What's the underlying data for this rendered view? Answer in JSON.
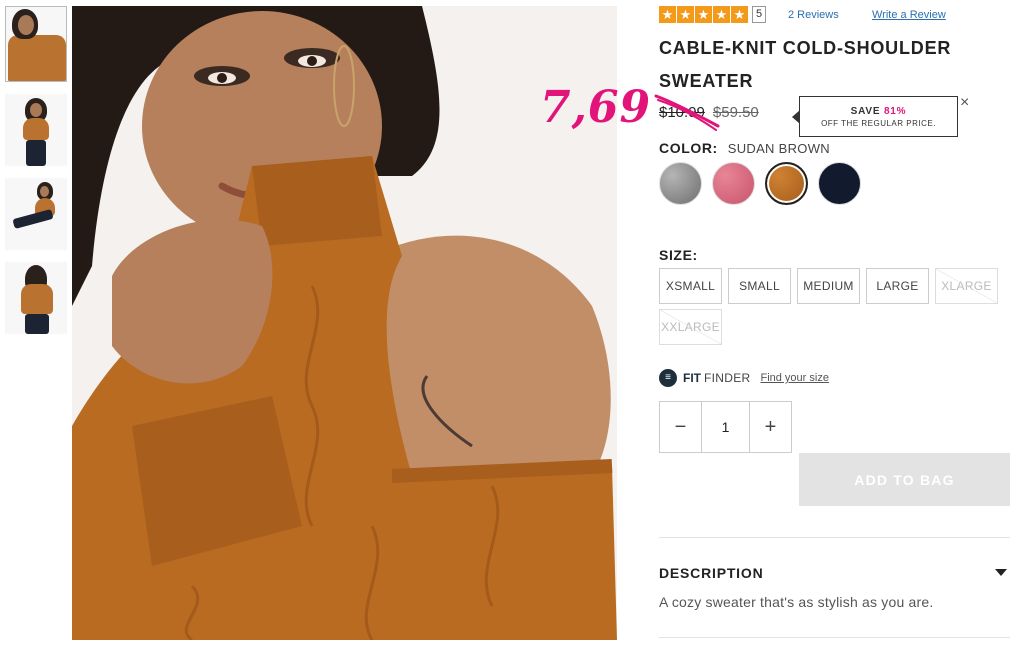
{
  "product": {
    "rating_stars": 5,
    "rating_count": "5",
    "reviews_link": "2 Reviews",
    "write_review": "Write a Review",
    "title": "CABLE-KNIT COLD-SHOULDER SWEATER",
    "handwritten_price": "7,69",
    "sale_price": "$10.99",
    "regular_price": "$59.50",
    "save_prefix": "SAVE",
    "save_percent": "81%",
    "save_note": "OFF THE REGULAR PRICE.",
    "color_label": "COLOR:",
    "color_value": "SUDAN BROWN",
    "swatches": [
      {
        "name": "heather-grey",
        "color": "#8c8c8c"
      },
      {
        "name": "rose-pink",
        "color": "#d9637a"
      },
      {
        "name": "sudan-brown",
        "color": "#b96b22",
        "selected": true
      },
      {
        "name": "navy",
        "color": "#121a2e"
      }
    ],
    "size_label": "SIZE:",
    "sizes": [
      {
        "label": "XSMALL",
        "available": true
      },
      {
        "label": "SMALL",
        "available": true
      },
      {
        "label": "MEDIUM",
        "available": true
      },
      {
        "label": "LARGE",
        "available": true
      },
      {
        "label": "XLARGE",
        "available": false
      },
      {
        "label": "XXLARGE",
        "available": false
      }
    ],
    "fit_bold": "FIT",
    "fit_thin": "FINDER",
    "fit_link": "Find your size",
    "qty_minus": "−",
    "qty_value": "1",
    "qty_plus": "+",
    "add_to_bag": "ADD TO BAG",
    "description_head": "DESCRIPTION",
    "description_text": "A cozy sweater that's as stylish as you are.",
    "close_symbol": "×"
  },
  "colors": {
    "accent_pink": "#e2147a",
    "star_orange": "#f39a1b",
    "link_blue": "#2c6fb0",
    "sweater": "#b96b22"
  }
}
